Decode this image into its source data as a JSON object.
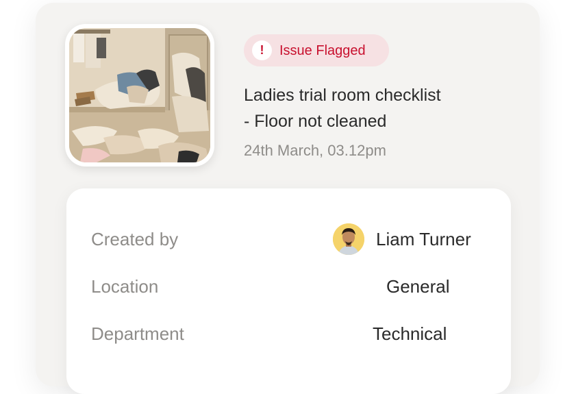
{
  "issue": {
    "status_badge": {
      "icon": "exclamation-icon",
      "icon_glyph": "!",
      "label": "Issue Flagged",
      "color": "#c8102e",
      "background": "#f6e1e3"
    },
    "title_line1": "Ladies trial room checklist",
    "title_line2": "- Floor not cleaned",
    "timestamp": "24th March, 03.12pm",
    "photo_alt": "Messy trial room with clothes on floor"
  },
  "details": {
    "created_by": {
      "label": "Created by",
      "value": "Liam Turner",
      "avatar_icon": "user-avatar"
    },
    "location": {
      "label": "Location",
      "value": "General"
    },
    "department": {
      "label": "Department",
      "value": "Technical"
    }
  }
}
